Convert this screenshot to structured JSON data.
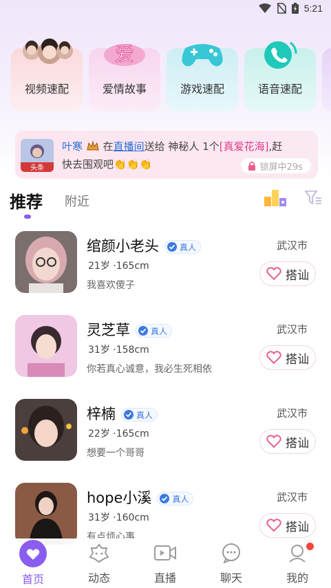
{
  "status": {
    "time": "5:21"
  },
  "categories": [
    {
      "label": "视频速配"
    },
    {
      "label": "爱情故事",
      "art_text": "爱"
    },
    {
      "label": "游戏速配"
    },
    {
      "label": "语音速配"
    }
  ],
  "banner": {
    "avatar_tag": "头条",
    "sender": "叶寒",
    "word_in": "在",
    "room_link": "直播间",
    "word_gift": "送给",
    "receiver": "神秘人",
    "count": "1个",
    "gift": "[真爱花海]",
    "tail": ",赶",
    "line2": "快去围观吧👏👏👏",
    "lock_text": "锁屏中29s"
  },
  "tabs": {
    "recommend": "推荐",
    "nearby": "附近"
  },
  "verified_label": "真人",
  "chat_label": "搭讪",
  "users": [
    {
      "name": "绾颜小老头",
      "age_height": "21岁 ·165cm",
      "bio": "我喜欢傻子",
      "city": "武汉市"
    },
    {
      "name": "灵芝草",
      "age_height": "31岁 ·158cm",
      "bio": "你若真心诚意，我必生死相依",
      "city": "武汉市"
    },
    {
      "name": "梓楠",
      "age_height": "22岁 ·165cm",
      "bio": "想要一个哥哥",
      "city": "武汉市"
    },
    {
      "name": "hope小溪",
      "age_height": "31岁 ·160cm",
      "bio": "有点烦心事",
      "city": "武汉市"
    }
  ],
  "nav": [
    {
      "label": "首页"
    },
    {
      "label": "动态"
    },
    {
      "label": "直播"
    },
    {
      "label": "聊天"
    },
    {
      "label": "我的"
    }
  ],
  "colors": {
    "accent": "#8a5cf0",
    "verified": "#3b7ae0",
    "heart": "#e8608a",
    "gift": "#e23b8a",
    "link": "#2a6fd6"
  }
}
